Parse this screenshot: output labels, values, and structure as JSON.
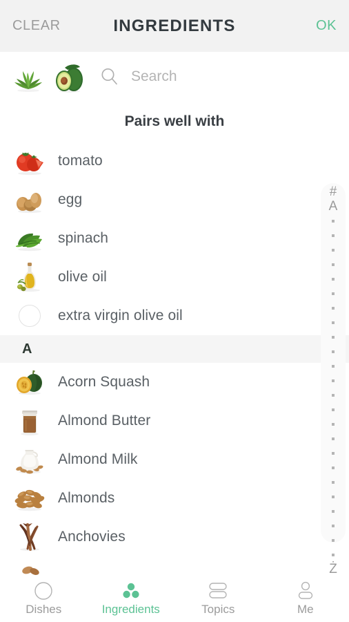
{
  "header": {
    "clear_label": "CLEAR",
    "title": "INGREDIENTS",
    "ok_label": "OK",
    "accent_color": "#5cc294",
    "muted_color": "#9b9b9b",
    "background": "#f2f2f2"
  },
  "search": {
    "placeholder": "Search",
    "value": "",
    "icon": "search-icon",
    "selected_chips": [
      {
        "name": "arugula",
        "icon": "arugula-thumbnail"
      },
      {
        "name": "avocado",
        "icon": "avocado-thumbnail"
      }
    ]
  },
  "pairs_section": {
    "title": "Pairs well with",
    "items": [
      {
        "label": "tomato",
        "icon": "tomato-thumbnail",
        "has_image": true
      },
      {
        "label": "egg",
        "icon": "egg-thumbnail",
        "has_image": true
      },
      {
        "label": "spinach",
        "icon": "spinach-thumbnail",
        "has_image": true
      },
      {
        "label": "olive oil",
        "icon": "olive-oil-thumbnail",
        "has_image": true
      },
      {
        "label": "extra virgin olive oil",
        "icon": "placeholder-circle-icon",
        "has_image": false
      }
    ]
  },
  "alpha_sections": [
    {
      "letter": "A",
      "items": [
        {
          "label": "Acorn Squash",
          "icon": "acorn-squash-thumbnail",
          "has_image": true
        },
        {
          "label": "Almond Butter",
          "icon": "almond-butter-thumbnail",
          "has_image": true
        },
        {
          "label": "Almond Milk",
          "icon": "almond-milk-thumbnail",
          "has_image": true
        },
        {
          "label": "Almonds",
          "icon": "almonds-thumbnail",
          "has_image": true
        },
        {
          "label": "Anchovies",
          "icon": "anchovies-thumbnail",
          "has_image": true
        }
      ]
    }
  ],
  "index_scrubber": {
    "top_labels": [
      "#",
      "A"
    ],
    "bottom_label": "Ż",
    "collapsed_dot_count": 24,
    "dot_color": "#b5b5b5",
    "background": "#fafafa"
  },
  "tab_bar": {
    "active": "Ingredients",
    "tabs": [
      {
        "label": "Dishes",
        "icon": "circle-outline-icon",
        "active": false
      },
      {
        "label": "Ingredients",
        "icon": "three-dots-triangle-icon",
        "active": true
      },
      {
        "label": "Topics",
        "icon": "two-pills-icon",
        "active": false
      },
      {
        "label": "Me",
        "icon": "person-icon",
        "active": false
      }
    ]
  }
}
